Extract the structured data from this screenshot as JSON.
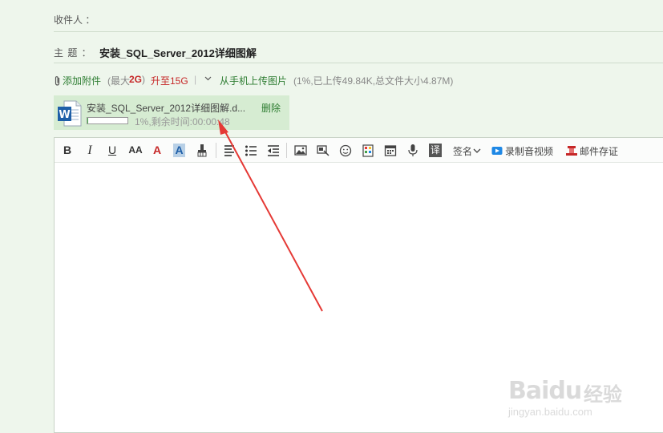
{
  "recipients": {
    "label": "收件人 ："
  },
  "subject": {
    "label": "主 题 ：",
    "value": "安装_SQL_Server_2012详细图解"
  },
  "attach_bar": {
    "add_attachment": "添加附件",
    "max_prefix": "(最大",
    "max_size": "2G",
    "max_suffix": ")",
    "upgrade": "升至15G",
    "divider": "|",
    "mobile_upload": "从手机上传图片",
    "status": "(1%,已上传49.84K,总文件大小4.87M)"
  },
  "file": {
    "name": "安装_SQL_Server_2012详细图解.d...",
    "delete_label": "删除",
    "progress_text": "1%,剩余时间:00:00:48",
    "progress": 0.01,
    "icon": "word-doc-icon"
  },
  "toolbar": {
    "bold": "B",
    "italic": "I",
    "underline": "U",
    "font_size": "AA",
    "font_color": "A",
    "bg_color": "A",
    "signature": "签名",
    "record_video": "录制音视频",
    "mail_save": "邮件存证",
    "translate": "译"
  },
  "watermark": {
    "brand": "Baidu",
    "cn": "经验",
    "url": "jingyan.baidu.com"
  },
  "colors": {
    "accent_green": "#2e7d32",
    "accent_red": "#c62828",
    "background": "#eef6ec"
  }
}
